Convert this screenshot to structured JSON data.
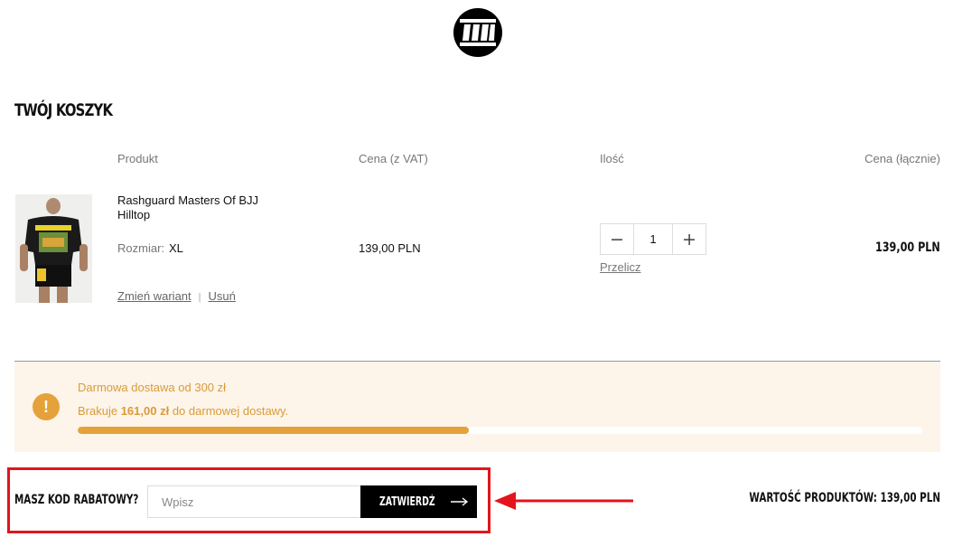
{
  "brand": {
    "logo_icon": "pitbull-logo-icon"
  },
  "cart": {
    "title": "TWÓJ KOSZYK",
    "columns": {
      "product": "Produkt",
      "price": "Cena (z VAT)",
      "quantity": "Ilość",
      "total": "Cena (łącznie)"
    },
    "items": [
      {
        "name": "Rashguard Masters Of BJJ Hilltop",
        "size_label": "Rozmiar:",
        "size_value": "XL",
        "change_variant": "Zmień wariant",
        "remove": "Usuń",
        "unit_price": "139,00 PLN",
        "quantity": "1",
        "recalculate": "Przelicz",
        "line_total": "139,00 PLN"
      }
    ]
  },
  "shipping": {
    "line1": "Darmowa dostawa od 300 zł",
    "line2_prefix": "Brakuje",
    "line2_amount": "161,00 zł",
    "line2_suffix": "do darmowej dostawy.",
    "progress_fraction": 0.463,
    "accent_color": "#e5a23a",
    "background_color": "#fdf4ea"
  },
  "coupon": {
    "label": "MASZ KOD RABATOWY?",
    "placeholder": "Wpisz",
    "submit_label": "ZATWIERDŹ",
    "highlight_color": "#e3141b"
  },
  "summary": {
    "products_value": "WARTOŚĆ PRODUKTÓW: 139,00 PLN"
  }
}
